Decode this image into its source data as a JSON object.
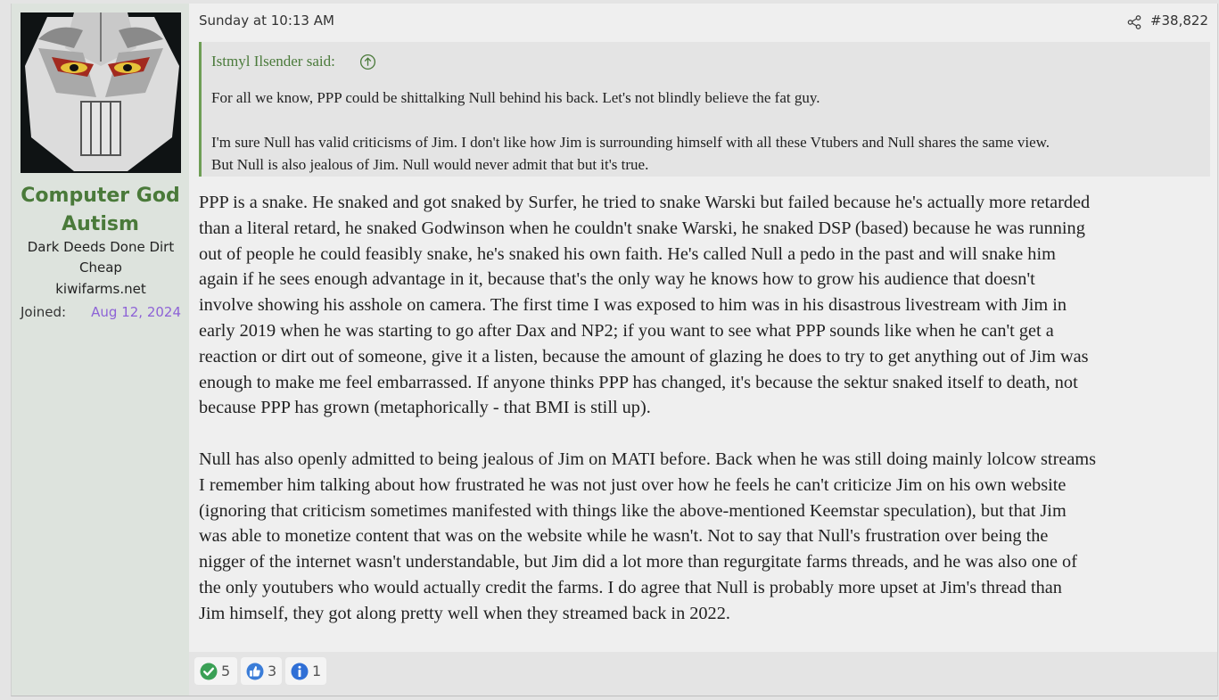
{
  "user": {
    "name": "Computer God Autism",
    "title": "Dark Deeds Done Dirt Cheap",
    "site": "kiwifarms.net",
    "joined_label": "Joined:",
    "joined_date": "Aug 12, 2024"
  },
  "post": {
    "date": "Sunday at 10:13 AM",
    "number": "#38,822",
    "quote": {
      "author_line": "Istmyl Ilsender said:",
      "paragraphs": [
        "For all we know, PPP could be shittalking Null behind his back. Let's not blindly believe the fat guy.",
        "I'm sure Null has valid criticisms of Jim. I don't like how Jim is surrounding himself with all these Vtubers and Null shares the same view.",
        "But Null is also jealous of Jim. Null would never admit that but it's true."
      ]
    },
    "body": {
      "p1": [
        "PPP is a snake. He snaked and got snaked by Surfer, he tried to snake Warski but failed because he's actually more retarded",
        "than a literal retard, he snaked Godwinson when he couldn't snake Warski, he snaked DSP (based) because he was running",
        "out of people he could feasibly snake, he's snaked his own faith. He's called Null a pedo in the past and will snake him",
        "again if he sees enough advantage in it, because that's the only way he knows how to grow his audience that doesn't",
        "involve showing his asshole on camera. The first time I was exposed to him was in his disastrous livestream with Jim in",
        "early 2019 when he was starting to go after Dax and NP2; if you want to see what PPP sounds like when he can't get a",
        "reaction or dirt out of someone, give it a listen, because the amount of glazing he does to try to get anything out of Jim was",
        "enough to make me feel embarrassed. If anyone thinks PPP has changed, it's because the sektur snaked itself to death, not",
        "because PPP has grown (metaphorically - that BMI is still up)."
      ],
      "p2": [
        "Null has also openly admitted to being jealous of Jim on MATI before. Back when he was still doing mainly lolcow streams",
        "I remember him talking about how frustrated he was not just over how he feels he can't criticize Jim on his own website",
        "(ignoring that criticism sometimes manifested with things like the above-mentioned Keemstar speculation), but that Jim",
        "was able to monetize content that was on the website while he wasn't. Not to say that Null's frustration over being the",
        "nigger of the internet wasn't understandable, but Jim did a lot more than regurgitate farms threads, and he was also one of",
        "the only youtubers who would actually credit the farms. I do agree that Null is probably more upset at Jim's thread than",
        "Jim himself, they got along pretty well when they streamed back in 2022."
      ]
    }
  },
  "reactions": [
    {
      "icon": "check-circle-icon",
      "count": "5",
      "color": "#3aa055"
    },
    {
      "icon": "thumbs-up-icon",
      "count": "3",
      "color": "#3b7dd8"
    },
    {
      "icon": "info-icon",
      "count": "1",
      "color": "#2f6fd6"
    }
  ],
  "colors": {
    "username": "#4a7a3a",
    "joined_date": "#8d63d6",
    "quote_border": "#6e9e55"
  }
}
